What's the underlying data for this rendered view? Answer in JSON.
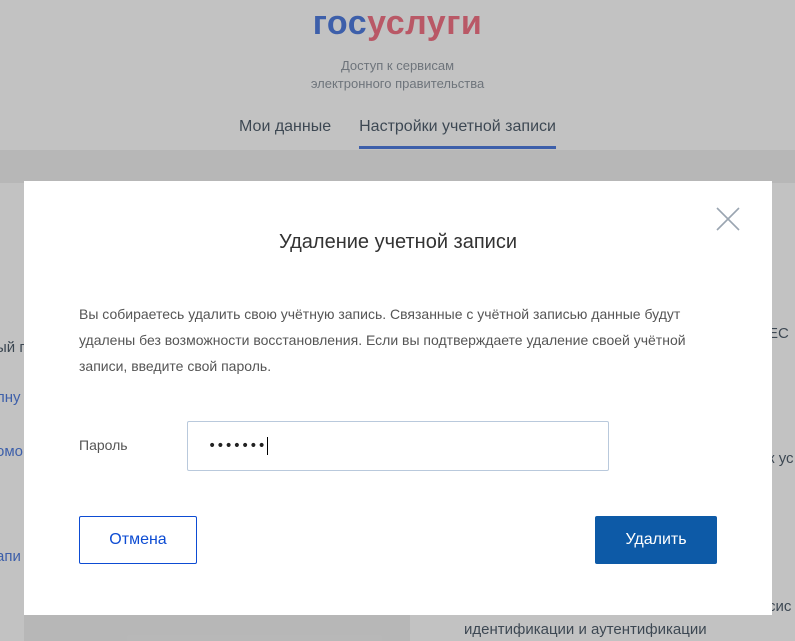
{
  "header": {
    "logo_gos": "гос",
    "logo_uslugi": "услуги",
    "tagline_line1": "Доступ к сервисам",
    "tagline_line2": "электронного правительства",
    "nav": [
      {
        "label": "Мои данные",
        "active": false
      },
      {
        "label": "Настройки учетной записи",
        "active": true
      }
    ]
  },
  "background": {
    "left_fragments": [
      "ый п",
      "лну",
      "омо",
      "апи"
    ],
    "right_fragments": [
      "ЕС",
      "к ус",
      "сис"
    ],
    "bottom_text": "идентификации и аутентификации"
  },
  "modal": {
    "title": "Удаление учетной записи",
    "text": "Вы собираетесь удалить свою учётную запись. Связанные с учётной записью данные будут удалены без возможности восстановления. Если вы подтверждаете удаление своей учётной записи, введите свой пароль.",
    "password_label": "Пароль",
    "password_value": "•••••••",
    "cancel_label": "Отмена",
    "delete_label": "Удалить",
    "close_icon": "close-icon"
  },
  "colors": {
    "brand_blue": "#0d4cd3",
    "brand_red": "#ee3f58",
    "primary_button": "#0d5aa7"
  }
}
